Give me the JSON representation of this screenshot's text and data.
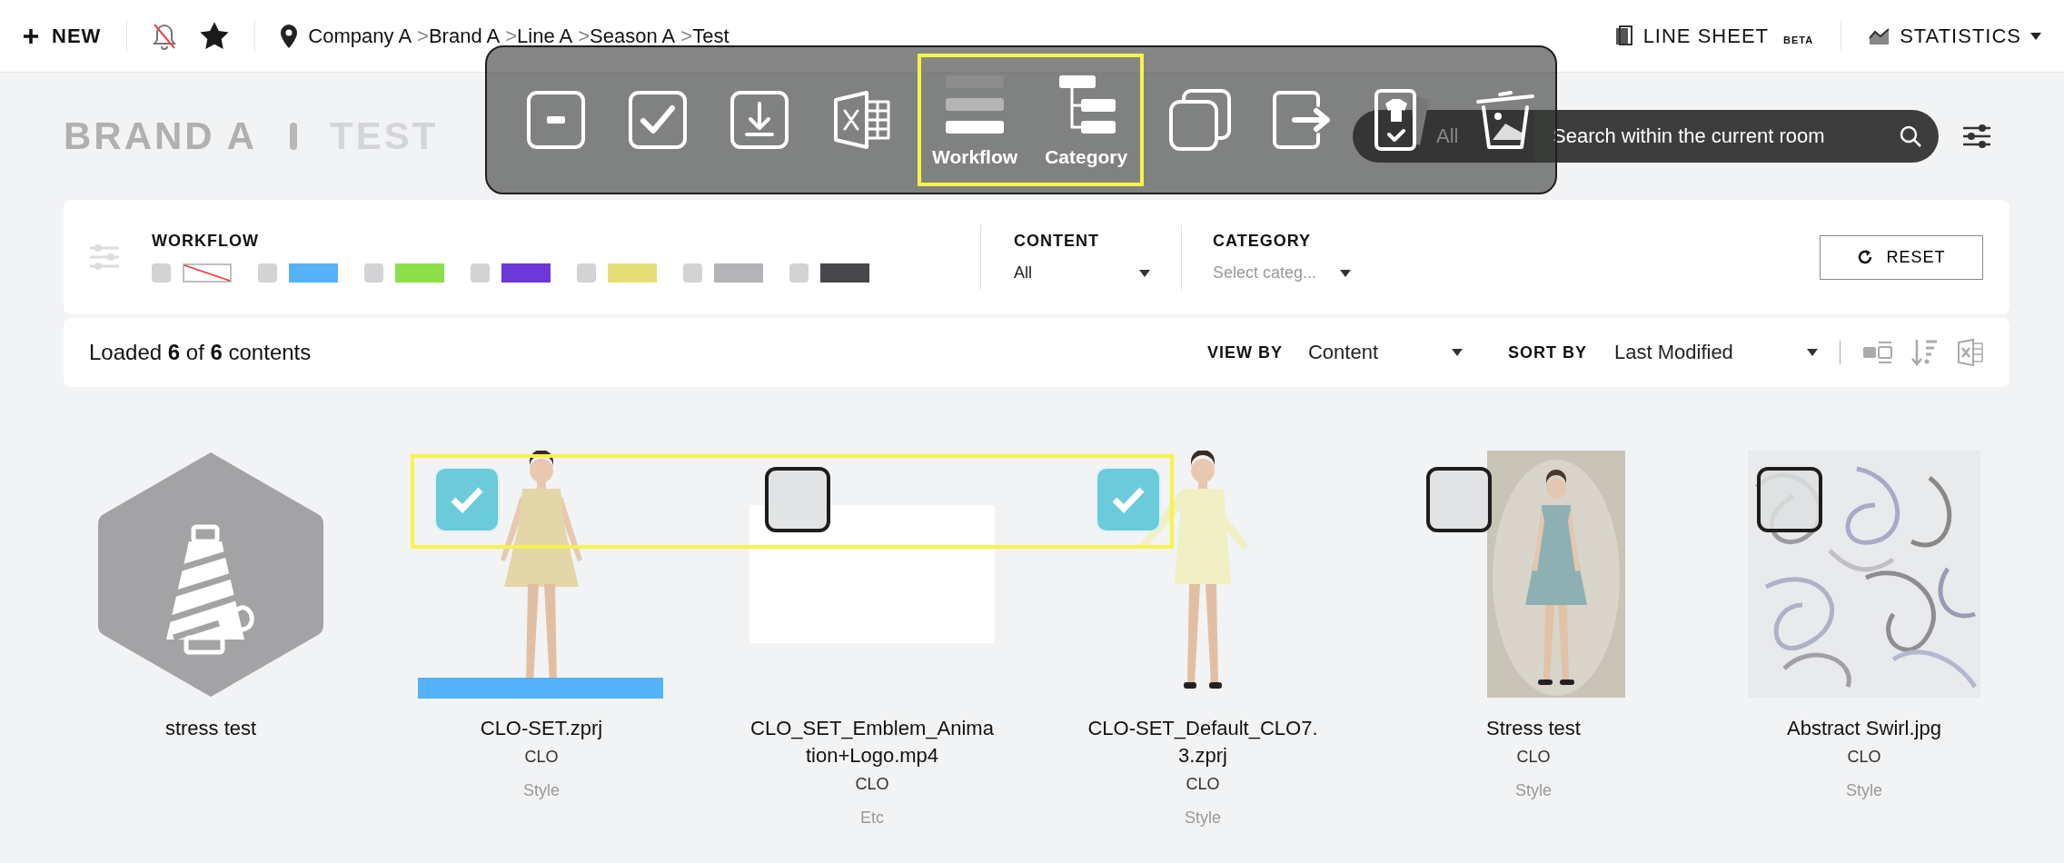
{
  "header": {
    "new_button": "NEW",
    "breadcrumbs": [
      {
        "label": "Company A",
        "separator": ">"
      },
      {
        "label": "Brand A",
        "separator": ">"
      },
      {
        "label": "Line A",
        "separator": ">"
      },
      {
        "label": "Season A",
        "separator": ">"
      },
      {
        "label": "Test"
      }
    ],
    "line_sheet": {
      "label": "LINE SHEET",
      "badge": "BETA"
    },
    "statistics": "STATISTICS"
  },
  "title": {
    "brand": "BRAND A",
    "room": "TEST"
  },
  "search": {
    "scope": "All",
    "placeholder": "Search within the current room"
  },
  "toolbar": [
    {
      "kind": "deselect",
      "highlighted": false
    },
    {
      "kind": "select-all",
      "highlighted": false
    },
    {
      "kind": "download",
      "highlighted": false
    },
    {
      "kind": "excel",
      "highlighted": false
    },
    {
      "kind": "workflow",
      "label": "Workflow",
      "highlighted": true
    },
    {
      "kind": "category",
      "label": "Category",
      "highlighted": true
    },
    {
      "kind": "copy",
      "highlighted": false
    },
    {
      "kind": "move",
      "highlighted": false
    },
    {
      "kind": "style-card",
      "highlighted": false
    },
    {
      "kind": "delete",
      "highlighted": false
    }
  ],
  "filters": {
    "workflow_label": "WORKFLOW",
    "statuses": [
      {
        "kind": "none",
        "checked": false
      },
      {
        "kind": "color",
        "color": "#55b1f8",
        "checked": false
      },
      {
        "kind": "color",
        "color": "#8be04a",
        "checked": false
      },
      {
        "kind": "color",
        "color": "#6c38d8",
        "checked": false
      },
      {
        "kind": "color",
        "color": "#e6df78",
        "checked": false
      },
      {
        "kind": "color",
        "color": "#b4b4b8",
        "checked": false
      },
      {
        "kind": "color",
        "color": "#47474b",
        "checked": false
      }
    ],
    "content": {
      "label": "CONTENT",
      "value": "All"
    },
    "category": {
      "label": "CATEGORY",
      "placeholder": "Select categ..."
    },
    "reset": "RESET"
  },
  "results": {
    "summary": "Loaded **6** of **6** contents",
    "view_by": {
      "label": "VIEW BY",
      "value": "Content"
    },
    "sort_by": {
      "label": "SORT BY",
      "value": "Last Modified"
    }
  },
  "cards": [
    {
      "kind": "folder",
      "title": "stress test"
    },
    {
      "kind": "dress",
      "title": "CLO-SET.zprj",
      "maker": "CLO",
      "type": "Style",
      "checked": true,
      "color": "#55b1f8"
    },
    {
      "kind": "blank",
      "title": "CLO_SET_Emblem_Animation+Logo.mp4",
      "maker": "CLO",
      "type": "Etc",
      "checked": false
    },
    {
      "kind": "coat",
      "title": "CLO-SET_Default_CLO7.3.zprj",
      "maker": "CLO",
      "type": "Style",
      "checked": true
    },
    {
      "title": "Stress test",
      "maker": "CLO",
      "type": "Style",
      "checked": false
    },
    {
      "kind": "pattern",
      "title": "Abstract Swirl.jpg",
      "maker": "CLO",
      "type": "Style",
      "checked": false
    }
  ],
  "selection_highlight": true
}
